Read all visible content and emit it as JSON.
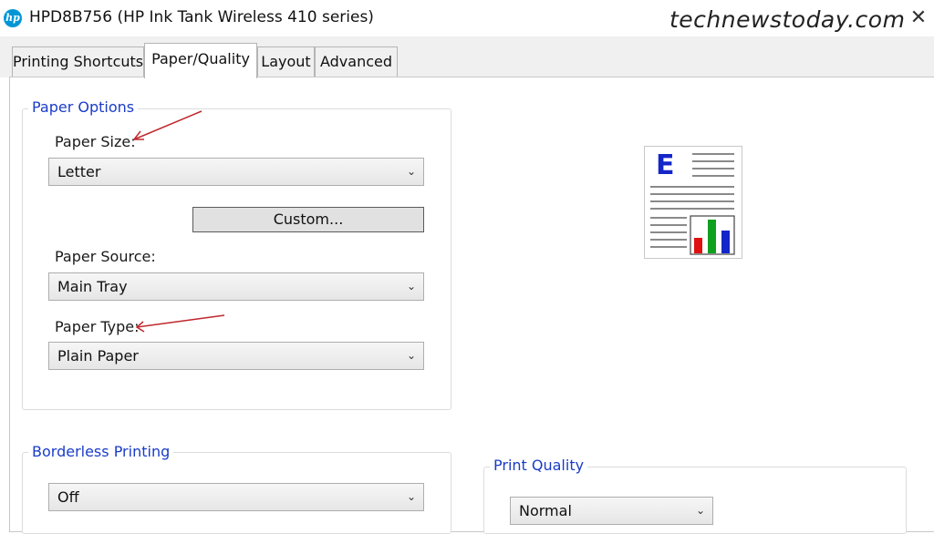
{
  "window": {
    "title": "HPD8B756 (HP Ink Tank Wireless 410 series)",
    "logo_text": "hp",
    "watermark": "technewstoday.com",
    "close_glyph": "✕"
  },
  "tabs": [
    {
      "label": "Printing Shortcuts",
      "active": false
    },
    {
      "label": "Paper/Quality",
      "active": true
    },
    {
      "label": "Layout",
      "active": false
    },
    {
      "label": "Advanced",
      "active": false
    }
  ],
  "paper_options": {
    "title": "Paper Options",
    "paper_size": {
      "label": "Paper Size:",
      "value": "Letter"
    },
    "custom_button": "Custom...",
    "paper_source": {
      "label": "Paper Source:",
      "value": "Main Tray"
    },
    "paper_type": {
      "label": "Paper Type:",
      "value": "Plain Paper"
    }
  },
  "borderless": {
    "title": "Borderless Printing",
    "value": "Off"
  },
  "print_quality": {
    "title": "Print Quality",
    "value": "Normal"
  },
  "preview": {
    "letter": "E"
  },
  "colors": {
    "accent_title": "#1a3cc8",
    "annotation_arrow": "#c0282d",
    "hp_blue": "#0096d6"
  },
  "icons": [
    "hp-logo-icon",
    "close-icon",
    "chevron-down-icon",
    "document-preview-icon"
  ]
}
